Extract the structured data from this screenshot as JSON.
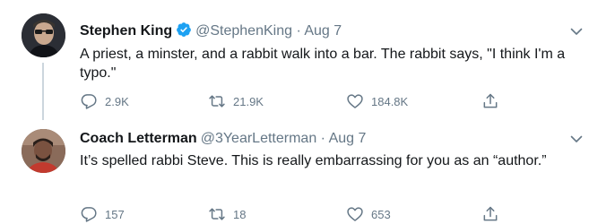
{
  "tweets": [
    {
      "name": "Stephen King",
      "verified": true,
      "handle": "@StephenKing",
      "separator": "·",
      "date": "Aug 7",
      "text": "A priest, a minster, and a rabbit walk into a bar. The rabbit says, \"I think I'm a typo.\"",
      "replies": "2.9K",
      "retweets": "21.9K",
      "likes": "184.8K"
    },
    {
      "name": "Coach Letterman",
      "verified": false,
      "handle": "@3YearLetterman",
      "separator": "·",
      "date": "Aug 7",
      "text": "It’s spelled rabbi Steve. This is really embarrassing for you as an “author.”",
      "replies": "157",
      "retweets": "18",
      "likes": "653"
    }
  ],
  "colors": {
    "text": "#14171a",
    "secondary": "#657786",
    "verified": "#1da1f2",
    "thread_line": "#ccd6dd"
  },
  "icons": [
    "verified-badge-icon",
    "chevron-down-icon",
    "reply-icon",
    "retweet-icon",
    "like-icon",
    "share-icon"
  ]
}
